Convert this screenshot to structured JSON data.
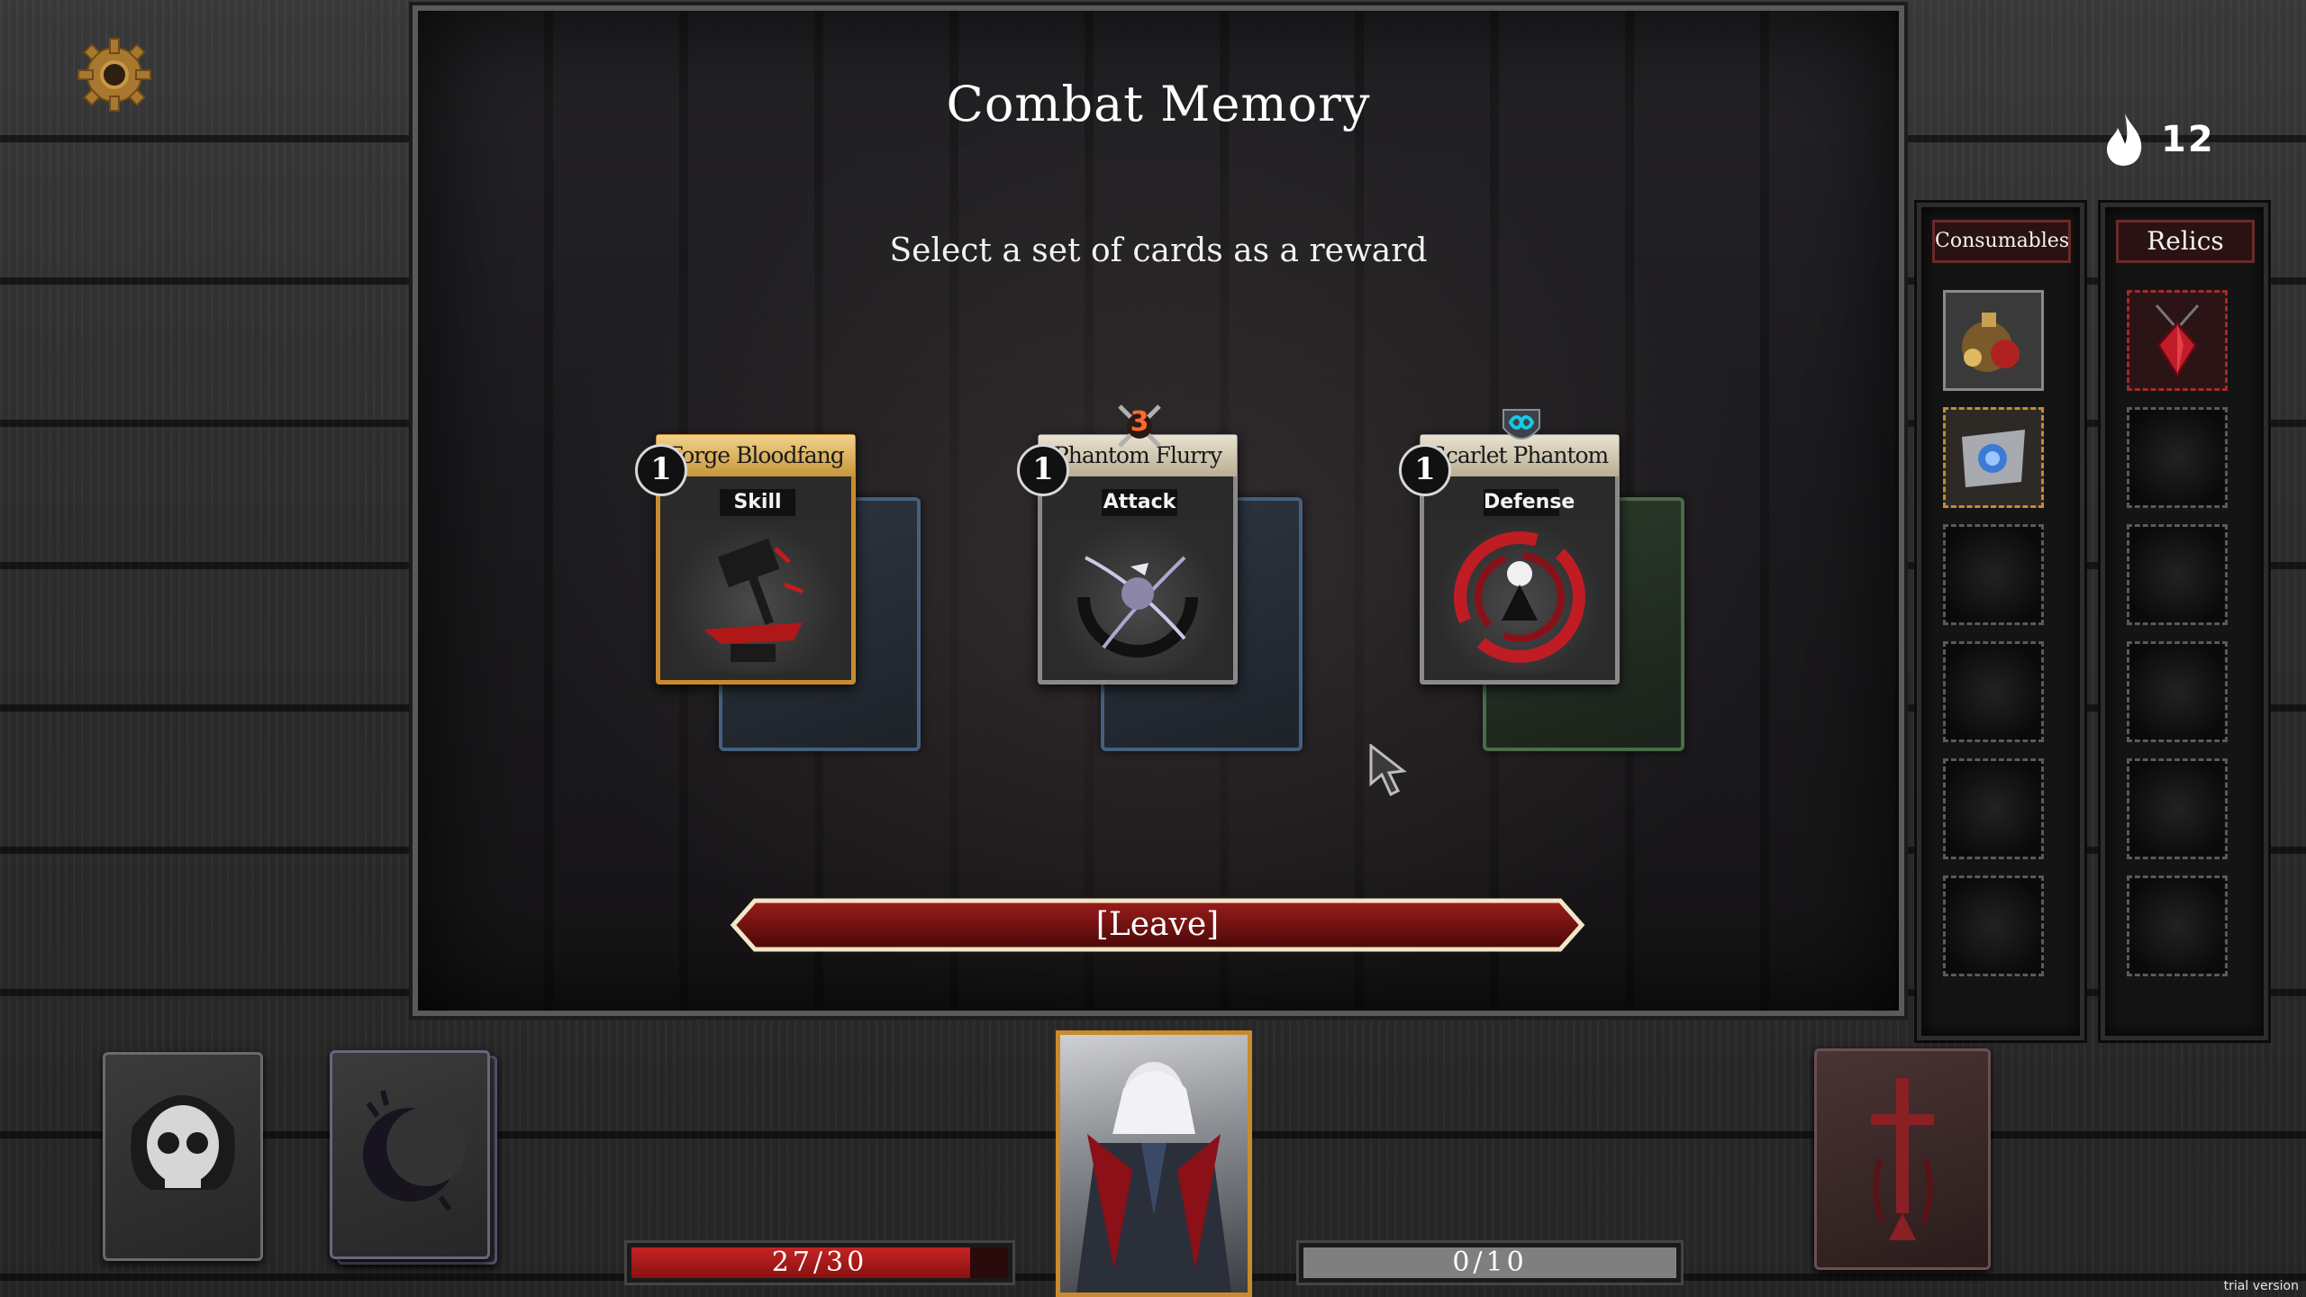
{
  "topbar": {
    "settings_icon": "gear-icon",
    "resource_icon": "soul-flame-icon",
    "resource_count": "12"
  },
  "reward": {
    "title": "Combat Memory",
    "subtitle": "Select a set of cards as a reward",
    "cards": [
      {
        "name": "Forge Bloodfang",
        "type": "Skill",
        "cost": "1",
        "rarity_color": "#c98a2e",
        "badge": ""
      },
      {
        "name": "Phantom Flurry",
        "type": "Attack",
        "cost": "1",
        "rarity_color": "#8a8a8a",
        "badge": "3"
      },
      {
        "name": "Scarlet Phantom",
        "type": "Defense",
        "cost": "1",
        "rarity_color": "#8a8a8a",
        "badge": "infinity"
      }
    ],
    "leave_label": "[Leave]"
  },
  "consumables": {
    "title": "Consumables",
    "slots_filled": 2,
    "slots_total": 6
  },
  "relics": {
    "title": "Relics",
    "slots_filled": 1,
    "slots_total": 6
  },
  "player": {
    "hp_text": "27/30",
    "hp_fraction": 0.9,
    "armor_text": "0/10",
    "armor_fraction": 0.0
  },
  "colors": {
    "accent_gold": "#c98a2e",
    "hp_red": "#c42424",
    "relic_red": "#a02c2c"
  },
  "footer": {
    "trial_label": "trial version"
  }
}
